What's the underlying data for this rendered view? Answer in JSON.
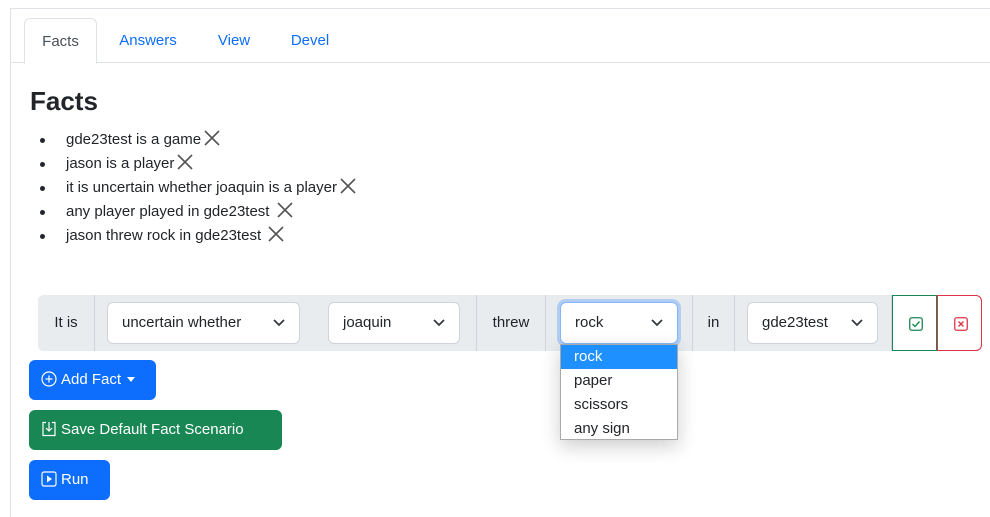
{
  "tabs": [
    {
      "label": "Facts",
      "active": true
    },
    {
      "label": "Answers"
    },
    {
      "label": "View"
    },
    {
      "label": "Devel"
    }
  ],
  "page_title": "Facts",
  "facts": [
    "gde23test is a game",
    "jason is a player",
    "it is uncertain whether joaquin is a player",
    "any player played in gde23test ",
    "jason threw rock in gde23test "
  ],
  "fact_builder": {
    "prefix": "It is",
    "modality": "uncertain whether",
    "subject": "joaquin",
    "verb": "threw",
    "object": "rock",
    "preposition": "in",
    "game": "gde23test",
    "object_options": [
      "rock",
      "paper",
      "scissors",
      "any sign"
    ],
    "highlighted_option": "rock"
  },
  "buttons": {
    "add_fact": "Add Fact",
    "save_default": "Save Default Fact Scenario",
    "run": "Run"
  },
  "colors": {
    "primary": "#0d6efd",
    "success": "#198754",
    "danger": "#dc3545",
    "confirm_green": "#198754",
    "highlight": "#1e90ff"
  }
}
